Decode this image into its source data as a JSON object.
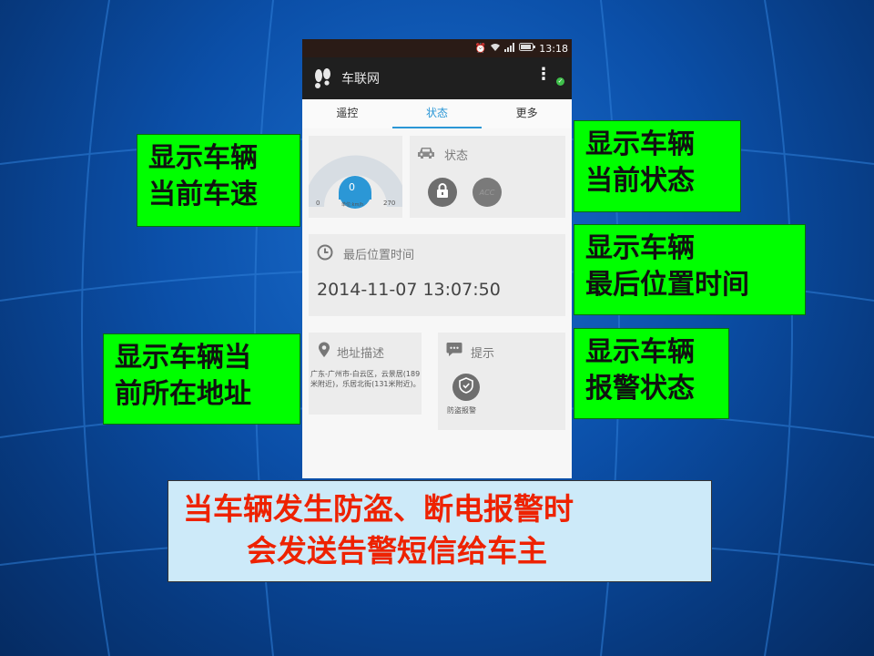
{
  "statusbar": {
    "time": "13:18",
    "icons": [
      "alarm-icon",
      "wifi-icon",
      "signal-icon",
      "battery-icon"
    ]
  },
  "app": {
    "title": "车联网",
    "overflow_icon": "more-vert-icon",
    "status_icon": "check-circle-icon"
  },
  "tabs": [
    {
      "label": "遥控",
      "active": false
    },
    {
      "label": "状态",
      "active": true
    },
    {
      "label": "更多",
      "active": false
    }
  ],
  "speed_card": {
    "value": "0",
    "min": "0",
    "max": "270",
    "unit": "单位:km/h",
    "level": 0
  },
  "status_card": {
    "label": "状态",
    "buttons": [
      {
        "icon": "lock-icon"
      },
      {
        "icon": "acc-icon",
        "text": "ACC"
      }
    ]
  },
  "time_card": {
    "label": "最后位置时间",
    "value": "2014-11-07 13:07:50"
  },
  "address_card": {
    "label": "地址描述",
    "text": "广东-广州市-白云区，云景居(189米附近)，乐居北街(131米附近)。"
  },
  "alarm_card": {
    "label": "提示",
    "item_label": "防盗报警"
  },
  "callouts": {
    "speed": [
      "显示车辆",
      "当前车速"
    ],
    "status": [
      "显示车辆",
      "当前状态"
    ],
    "time": [
      "显示车辆",
      "最后位置时间"
    ],
    "address": [
      "显示车辆当",
      "前所在地址"
    ],
    "alarm": [
      "显示车辆",
      "报警状态"
    ]
  },
  "notice": [
    "当车辆发生防盗、断电报警时",
    "会发送告警短信给车主"
  ],
  "colors": {
    "callout_bg": "#00ff00",
    "notice_bg": "#cdeaf9",
    "notice_text": "#ee2200",
    "tab_active": "#2b97d6"
  }
}
